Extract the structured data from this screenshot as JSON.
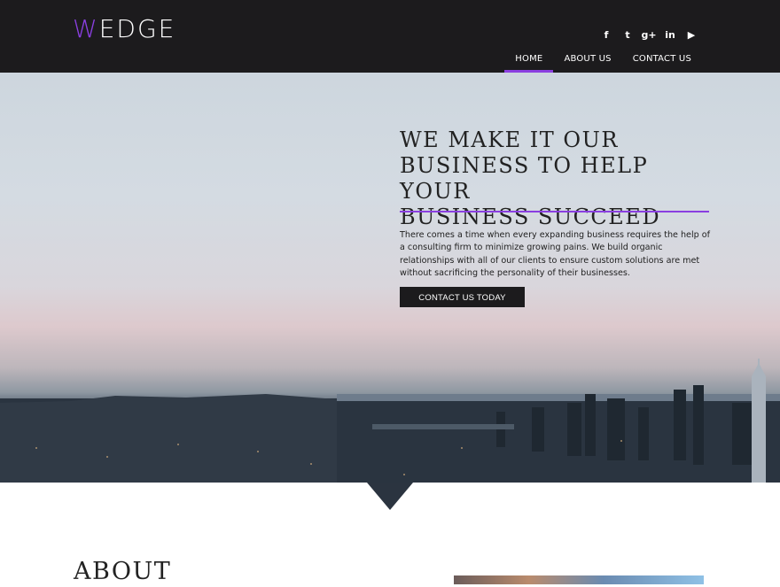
{
  "brand": {
    "logo_first": "W",
    "logo_rest": "EDGE",
    "accent": "#8a3fe0"
  },
  "social": [
    {
      "icon": "facebook-icon",
      "glyph": "f"
    },
    {
      "icon": "twitter-icon",
      "glyph": "t"
    },
    {
      "icon": "google-plus-icon",
      "glyph": "g+"
    },
    {
      "icon": "linkedin-icon",
      "glyph": "in"
    },
    {
      "icon": "youtube-icon",
      "glyph": "▶"
    }
  ],
  "nav": {
    "home": "HOME",
    "about": "ABOUT US",
    "contact": "CONTACT US"
  },
  "hero": {
    "title_line1": "WE MAKE IT OUR",
    "title_line2": "BUSINESS TO HELP YOUR",
    "title_line3": "BUSINESS SUCCEED",
    "text": "There comes a time when every expanding business requires the help of a consulting firm to minimize growing pains. We build organic relationships with all of our clients to ensure custom solutions are met without sacrificing the personality of their businesses.",
    "button": "CONTACT US TODAY"
  },
  "about": {
    "heading": "ABOUT"
  }
}
